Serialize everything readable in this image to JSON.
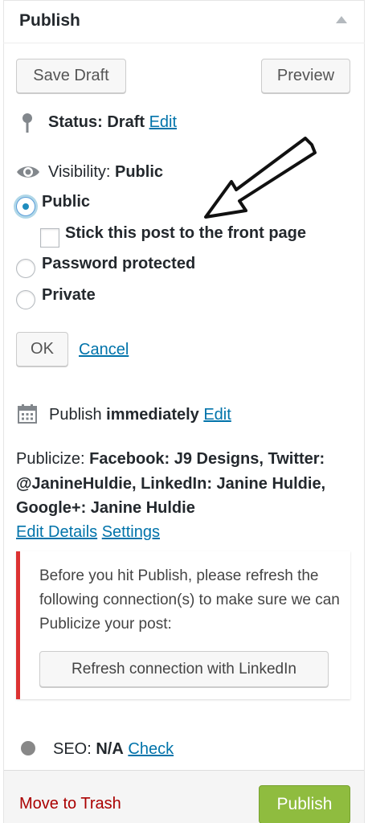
{
  "header": {
    "title": "Publish"
  },
  "buttons": {
    "save_draft": "Save Draft",
    "preview": "Preview",
    "ok": "OK",
    "cancel": "Cancel"
  },
  "status": {
    "label": "Status:",
    "value": "Draft",
    "edit": "Edit"
  },
  "visibility": {
    "label": "Visibility:",
    "value": "Public",
    "options": [
      {
        "label": "Public",
        "checked": true
      },
      {
        "label": "Password protected",
        "checked": false
      },
      {
        "label": "Private",
        "checked": false
      }
    ],
    "sticky_label": "Stick this post to the front page"
  },
  "schedule": {
    "prefix": "Publish",
    "value": "immediately",
    "edit": "Edit"
  },
  "publicize": {
    "prefix": "Publicize:",
    "line1": "Facebook: J9 Designs, Twitter:",
    "line2": "@JanineHuldie, LinkedIn: Janine Huldie,",
    "line3": "Google+: Janine Huldie",
    "edit_details": "Edit Details",
    "settings": "Settings"
  },
  "notice": {
    "message": "Before you hit Publish, please refresh the following connection(s) to make sure we can Publicize your post:",
    "refresh_button": "Refresh connection with LinkedIn",
    "accent_color": "#dc3232"
  },
  "seo": {
    "label": "SEO:",
    "value": "N/A",
    "check": "Check"
  },
  "footer": {
    "trash": "Move to Trash",
    "publish": "Publish",
    "publish_color": "#8fbc3f"
  },
  "icons": [
    "pin-icon",
    "eye-icon",
    "calendar-icon",
    "seo-dot-icon",
    "arrow-annotation-icon",
    "collapse-toggle-icon"
  ]
}
